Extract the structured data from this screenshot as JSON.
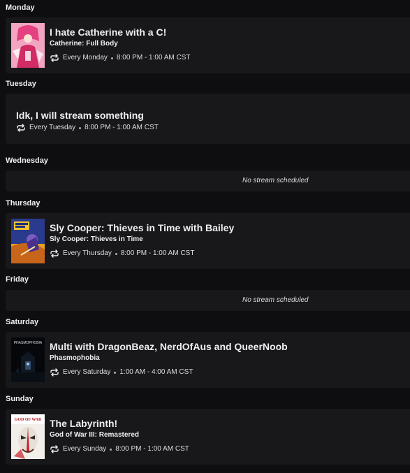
{
  "days": [
    {
      "name": "Monday",
      "title": "I hate Catherine with a C!",
      "game": "Catherine: Full Body",
      "recurrence": "Every Monday",
      "time": "8:00 PM - 1:00 AM CST",
      "cover": "catherine-cover"
    },
    {
      "name": "Tuesday",
      "title": "Idk, I will stream something",
      "recurrence": "Every Tuesday",
      "time": "8:00 PM - 1:00 AM CST"
    },
    {
      "name": "Wednesday",
      "empty": "No stream scheduled"
    },
    {
      "name": "Thursday",
      "title": "Sly Cooper: Thieves in Time with Bailey",
      "game": "Sly Cooper: Thieves in Time",
      "recurrence": "Every Thursday",
      "time": "8:00 PM - 1:00 AM CST",
      "cover": "sly-cooper-cover"
    },
    {
      "name": "Friday",
      "empty": "No stream scheduled"
    },
    {
      "name": "Saturday",
      "title": "Multi with DragonBeaz, NerdOfAus and QueerNoob",
      "game": "Phasmophobia",
      "recurrence": "Every Saturday",
      "time": "1:00 AM - 4:00 AM CST",
      "cover": "phasmophobia-cover",
      "cover_text": "PHASMOPHOBIA"
    },
    {
      "name": "Sunday",
      "title": "The Labyrinth!",
      "game": "God of War III: Remastered",
      "recurrence": "Every Sunday",
      "time": "8:00 PM - 1:00 AM CST",
      "cover": "god-of-war-cover",
      "cover_text": "GOD OF WAR"
    }
  ],
  "colors": {
    "background": "#0e0e10",
    "card": "#18181b",
    "text": "#efeff1",
    "muted": "#adadb8"
  },
  "icons": {
    "recurrence": "repeat-icon"
  }
}
